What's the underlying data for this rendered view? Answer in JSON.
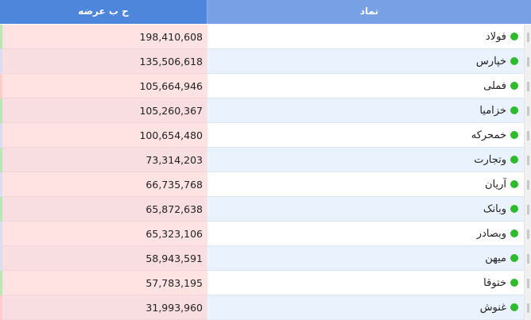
{
  "table": {
    "headers": {
      "volume": "ح ب عرضه",
      "symbol": "نماد"
    },
    "colors": {
      "volume_cell_bg": [
        "#ffe3e3",
        "#f8dde1"
      ],
      "symbol_cell_bg": [
        "#ffffff",
        "#eaf3fd"
      ],
      "status_dot": "#2dba2d",
      "stripe": [
        "#b9e6b4",
        "#dcdcf2",
        "#ffcccc"
      ]
    },
    "rows": [
      {
        "symbol": "فولاد",
        "volume": "198,410,608",
        "stripe": 0
      },
      {
        "symbol": "خپارس",
        "volume": "135,506,618",
        "stripe": 1
      },
      {
        "symbol": "فملی",
        "volume": "105,664,946",
        "stripe": 2
      },
      {
        "symbol": "خزامیا",
        "volume": "105,260,367",
        "stripe": 0
      },
      {
        "symbol": "خمحرکه",
        "volume": "100,654,480",
        "stripe": 1
      },
      {
        "symbol": "وتجارت",
        "volume": "73,314,203",
        "stripe": 0
      },
      {
        "symbol": "آریان",
        "volume": "66,735,768",
        "stripe": 1
      },
      {
        "symbol": "وبانک",
        "volume": "65,872,638",
        "stripe": 0
      },
      {
        "symbol": "وبصادر",
        "volume": "65,323,106",
        "stripe": 1
      },
      {
        "symbol": "میهن",
        "volume": "58,943,591",
        "stripe": 1
      },
      {
        "symbol": "ختوقا",
        "volume": "57,783,195",
        "stripe": 0
      },
      {
        "symbol": "غنوش",
        "volume": "31,993,960",
        "stripe": 2
      }
    ]
  }
}
